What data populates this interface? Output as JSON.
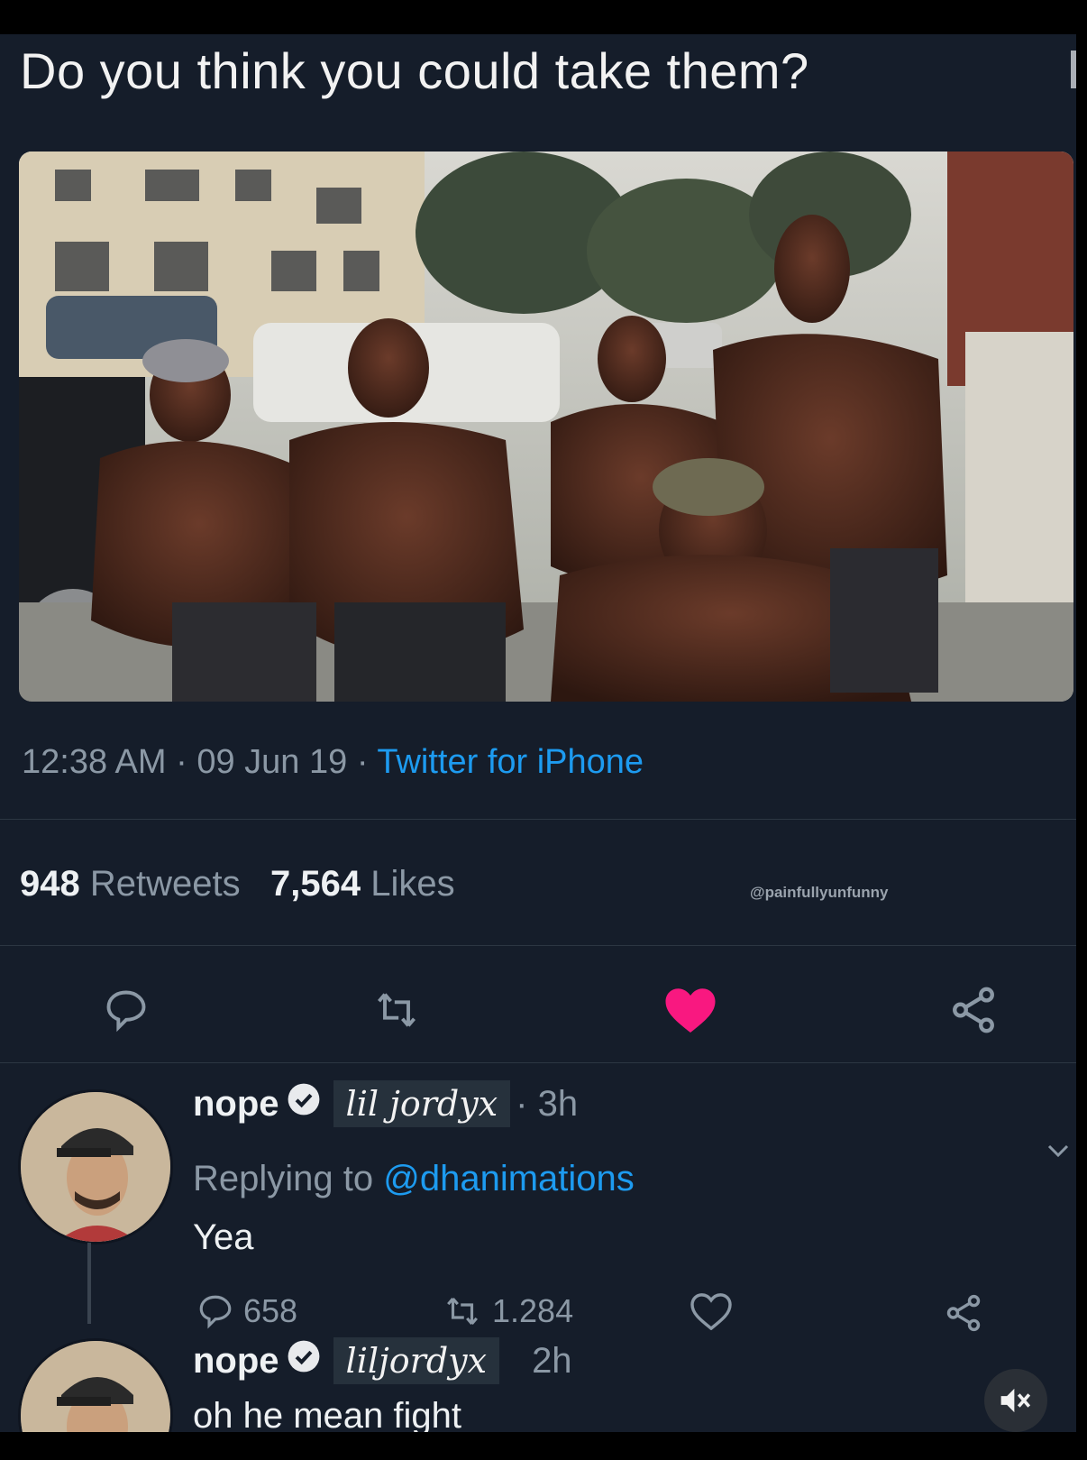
{
  "tweet": {
    "text": "Do you think you could take them?",
    "time": "12:38 AM",
    "date": "09 Jun 19",
    "source": "Twitter for iPhone",
    "retweets_count": "948",
    "retweets_label": "Retweets",
    "likes_count": "7,564",
    "likes_label": "Likes",
    "watermark": "@painfullyunfunny",
    "liked": true,
    "like_color": "#f91880"
  },
  "actions": {
    "reply_icon": "reply-icon",
    "retweet_icon": "retweet-icon",
    "like_icon": "heart-filled-icon",
    "share_icon": "share-icon"
  },
  "replies": [
    {
      "name": "nope",
      "handle": "lil jordyx",
      "time": "· 3h",
      "replying_prefix": "Replying to",
      "replying_to": "@dhanimations",
      "text": "Yea",
      "reply_count": "658",
      "retweet_count": "1.284"
    },
    {
      "name": "nope",
      "handle": "liljordyx",
      "time": "2h",
      "text": "oh he mean fight"
    }
  ],
  "colors": {
    "background": "#151d2a",
    "link": "#1d9bf0",
    "muted": "#8b98a5"
  }
}
